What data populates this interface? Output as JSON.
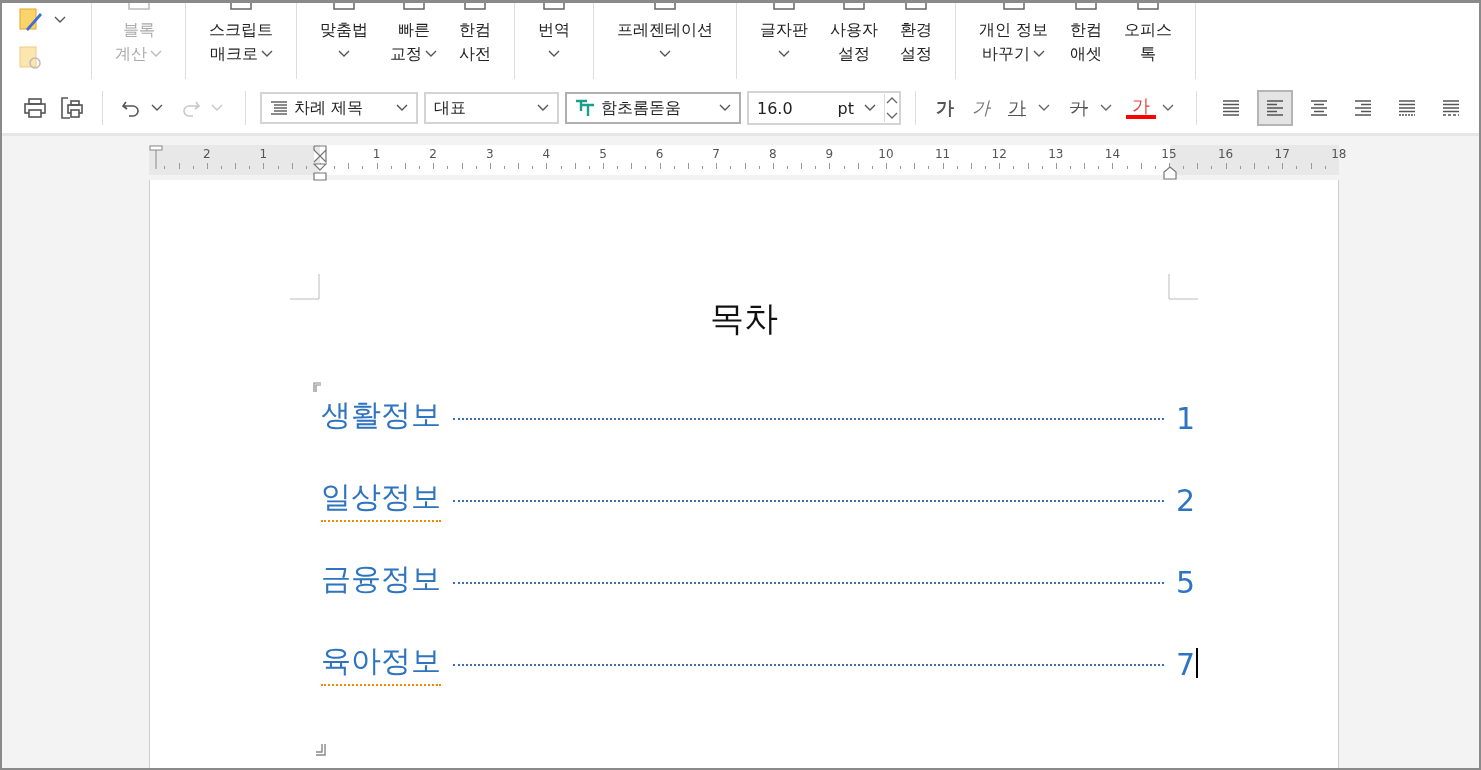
{
  "ribbon": {
    "groups": [
      {
        "kind": "quick"
      },
      {
        "kind": "buttons",
        "items": [
          {
            "lines": [
              "블록",
              "계산"
            ],
            "dropdown": true,
            "disabled": true
          }
        ]
      },
      {
        "kind": "buttons",
        "items": [
          {
            "lines": [
              "스크립트",
              "매크로"
            ],
            "dropdown": true,
            "disabled": false
          }
        ]
      },
      {
        "kind": "buttons",
        "items": [
          {
            "lines": [
              "맞춤법"
            ],
            "dropdown": true,
            "disabled": false
          },
          {
            "lines": [
              "빠른",
              "교정"
            ],
            "dropdown": true,
            "disabled": false
          },
          {
            "lines": [
              "한컴",
              "사전"
            ],
            "dropdown": false,
            "disabled": false
          }
        ]
      },
      {
        "kind": "buttons",
        "items": [
          {
            "lines": [
              "번역"
            ],
            "dropdown": true,
            "disabled": false
          }
        ]
      },
      {
        "kind": "buttons",
        "items": [
          {
            "lines": [
              "프레젠테이션"
            ],
            "dropdown": true,
            "disabled": false
          }
        ]
      },
      {
        "kind": "buttons",
        "items": [
          {
            "lines": [
              "글자판"
            ],
            "dropdown": true,
            "disabled": false
          },
          {
            "lines": [
              "사용자",
              "설정"
            ],
            "dropdown": false,
            "disabled": false
          },
          {
            "lines": [
              "환경",
              "설정"
            ],
            "dropdown": false,
            "disabled": false
          }
        ]
      },
      {
        "kind": "buttons",
        "items": [
          {
            "lines": [
              "개인 정보",
              "바꾸기"
            ],
            "dropdown": true,
            "disabled": false
          },
          {
            "lines": [
              "한컴",
              "애셋"
            ],
            "dropdown": false,
            "disabled": false
          },
          {
            "lines": [
              "오피스",
              "톡"
            ],
            "dropdown": false,
            "disabled": false
          }
        ]
      }
    ]
  },
  "toolbar": {
    "history": [
      {
        "kind": "undo",
        "disabled": false
      },
      {
        "kind": "redo",
        "disabled": true
      }
    ],
    "style": "차례 제목",
    "para_style": "대표",
    "font": "함초롬돋움",
    "size": "16.0",
    "unit": "pt",
    "char_buttons": [
      {
        "kind": "bold",
        "label": "가",
        "dropdown": false
      },
      {
        "kind": "italic",
        "label": "가",
        "dropdown": false
      },
      {
        "kind": "underline",
        "label": "가",
        "dropdown": true
      },
      {
        "kind": "strike",
        "label": "가",
        "dropdown": true
      },
      {
        "kind": "color",
        "label": "가",
        "dropdown": true
      }
    ],
    "align": [
      {
        "kind": "justify",
        "selected": false
      },
      {
        "kind": "left",
        "selected": true
      },
      {
        "kind": "center",
        "selected": false
      },
      {
        "kind": "right",
        "selected": false
      },
      {
        "kind": "distribute",
        "selected": false
      },
      {
        "kind": "split",
        "selected": false
      }
    ]
  },
  "ruler": {
    "labels": [
      "2",
      "1",
      "1",
      "2",
      "3",
      "4",
      "5",
      "6",
      "7",
      "8",
      "9",
      "10",
      "11",
      "12",
      "13",
      "14",
      "15",
      "16",
      "17",
      "18"
    ]
  },
  "document": {
    "title": "목차",
    "entries": [
      {
        "text": "생활정보",
        "page": "1",
        "spell_error": false,
        "cursor": false
      },
      {
        "text": "일상정보",
        "page": "2",
        "spell_error": true,
        "cursor": false
      },
      {
        "text": "금융정보",
        "page": "5",
        "spell_error": false,
        "cursor": false
      },
      {
        "text": "육아정보",
        "page": "7",
        "spell_error": true,
        "cursor": true
      }
    ]
  }
}
